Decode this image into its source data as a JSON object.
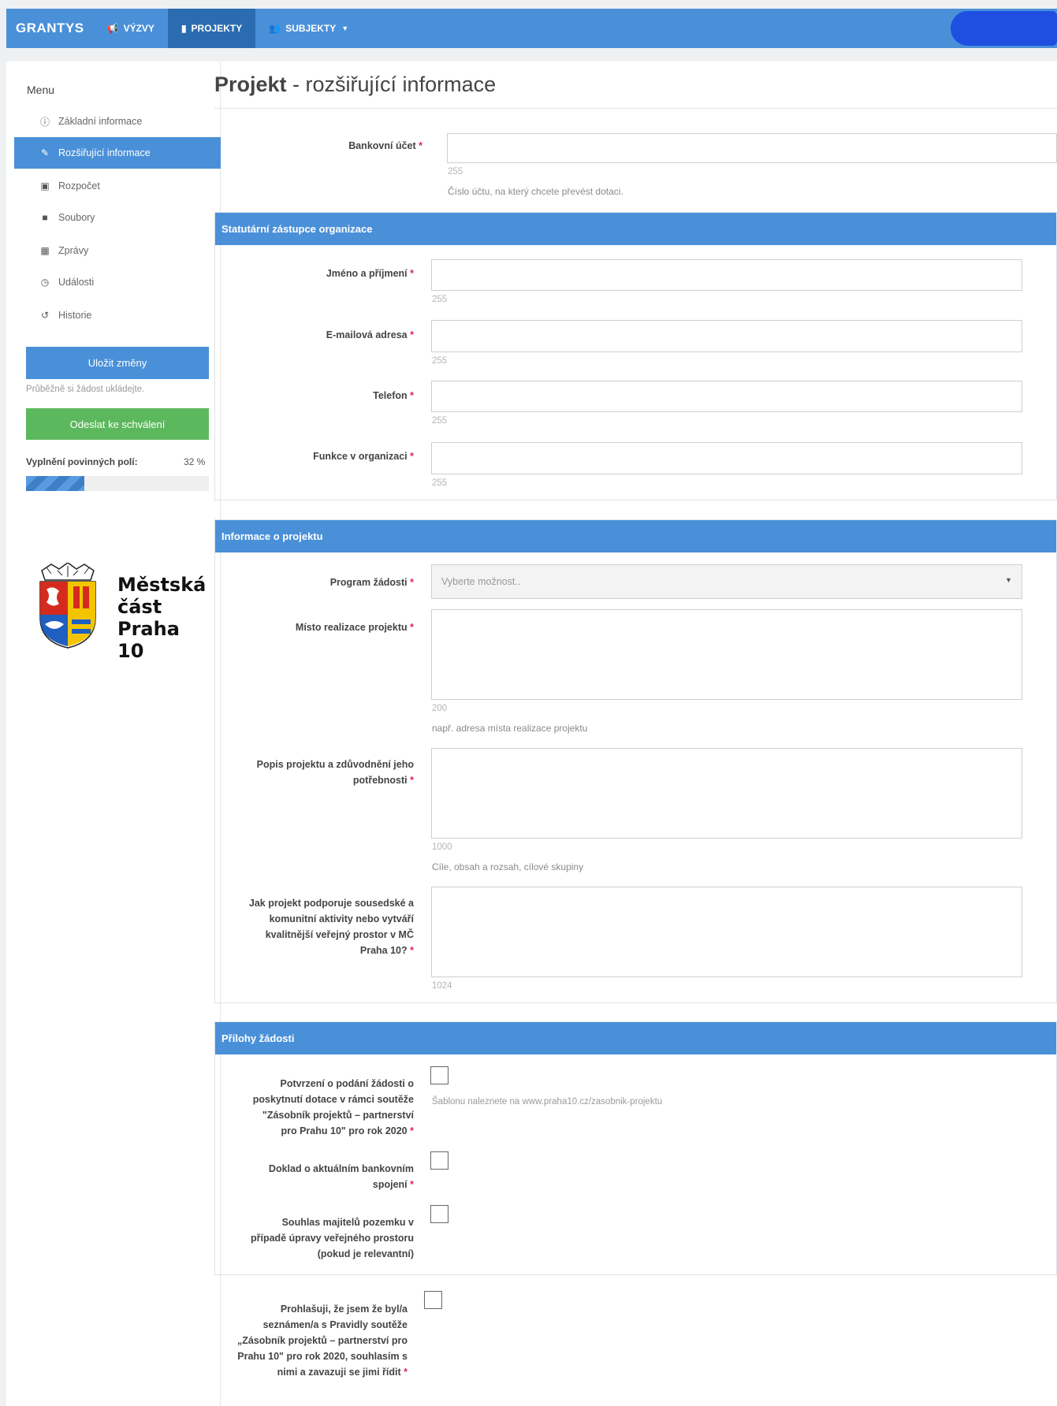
{
  "nav": {
    "brand": "GRANTYS",
    "items": [
      {
        "icon": "bullhorn-icon",
        "label": "VÝZVY"
      },
      {
        "icon": "file-icon",
        "label": "PROJEKTY"
      },
      {
        "icon": "users-icon",
        "label": "SUBJEKTY"
      }
    ],
    "active_index": 1,
    "accent": "#4a90d9"
  },
  "sidebar": {
    "menu_title": "Menu",
    "items": [
      {
        "icon": "info-circle-icon",
        "label": "Základní informace"
      },
      {
        "icon": "edit-icon",
        "label": "Rozšiřující informace"
      },
      {
        "icon": "money-icon",
        "label": "Rozpočet"
      },
      {
        "icon": "folder-icon",
        "label": "Soubory"
      },
      {
        "icon": "table-icon",
        "label": "Zprávy"
      },
      {
        "icon": "clock-icon",
        "label": "Události"
      },
      {
        "icon": "history-icon",
        "label": "Historie"
      }
    ],
    "active_index": 1,
    "save_button": "Uložit změny",
    "save_hint": "Průběžně si žádost ukládejte.",
    "send_button": "Odeslat ke schválení",
    "progress_label": "Vyplnění povinných polí:",
    "progress_value": "32 %",
    "progress_fraction": 0.32,
    "logo": {
      "line1": "Městská",
      "line2": "část",
      "line3": "Praha 10"
    }
  },
  "page": {
    "title_bold": "Projekt",
    "title_rest": " - rozšiřující informace"
  },
  "bank": {
    "label": "Bankovní účet",
    "counter": "255",
    "help": "Číslo účtu, na který chcete převést dotaci."
  },
  "statutory": {
    "heading": "Statutární zástupce organizace",
    "fields": [
      {
        "label": "Jméno a příjmení",
        "counter": "255"
      },
      {
        "label": "E-mailová adresa",
        "counter": "255"
      },
      {
        "label": "Telefon",
        "counter": "255"
      },
      {
        "label": "Funkce v organizaci",
        "counter": "255"
      }
    ]
  },
  "project": {
    "heading": "Informace o projektu",
    "program_label": "Program žádosti",
    "program_placeholder": "Vyberte možnost..",
    "place_label": "Místo realizace projektu",
    "place_counter": "200",
    "place_help": "např. adresa místa realizace projektu",
    "desc_label_1": "Popis projektu a zdůvodnění jeho",
    "desc_label_2": "potřebnosti",
    "desc_counter": "1000",
    "desc_help": "Cíle, obsah a rozsah, cílové skupiny",
    "support_label_1": "Jak projekt podporuje sousedské a",
    "support_label_2": "komunitní aktivity nebo vytváří",
    "support_label_3": "kvalitnější veřejný prostor v MČ",
    "support_label_4": "Praha 10?",
    "support_counter": "1024"
  },
  "attachments": {
    "heading": "Přílohy žádosti",
    "a1_lines": [
      "Potvrzení o podání žádosti o",
      "poskytnutí dotace v rámci soutěže",
      "\"Zásobník projektů – partnerství",
      "pro Prahu 10\" pro rok 2020"
    ],
    "a1_help": "Šablonu naleznete na www.praha10.cz/zasobnik-projektu",
    "a2_lines": [
      "Doklad o aktuálním bankovním",
      "spojení"
    ],
    "a3_lines": [
      "Souhlas majitelů pozemku v",
      "případě úpravy veřejného prostoru",
      "(pokud je relevantní)"
    ]
  },
  "declaration": {
    "lines": [
      "Prohlašuji, že jsem že byl/a",
      "seznámen/a s Pravidly soutěže",
      "„Zásobník projektů – partnerství pro",
      "Prahu 10\" pro rok 2020, souhlasím s",
      "nimi a zavazuji se jimi řídit"
    ]
  },
  "required_marker": "*"
}
